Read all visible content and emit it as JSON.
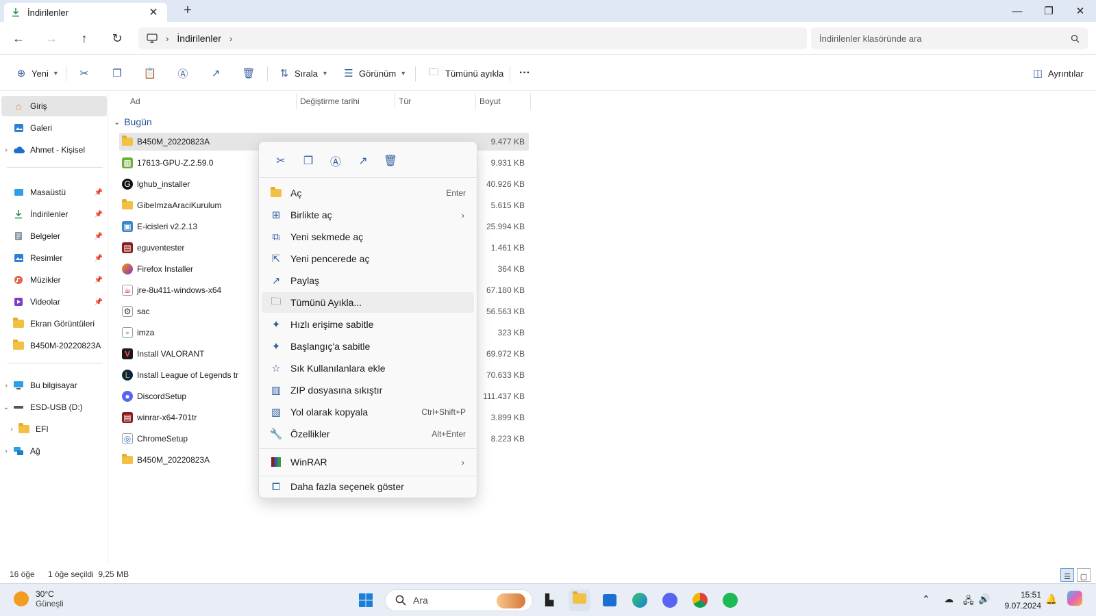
{
  "window": {
    "tab_title": "İndirilenler",
    "close_tab": "✕",
    "new_tab": "+",
    "minimize": "—",
    "maximize": "❐",
    "close": "✕"
  },
  "navigation": {
    "breadcrumb": [
      "İndirilenler"
    ],
    "search_placeholder": "İndirilenler klasöründe ara"
  },
  "commandbar": {
    "new": "Yeni",
    "sort": "Sırala",
    "view": "Görünüm",
    "extract_all": "Tümünü ayıkla",
    "more": "···",
    "details": "Ayrıntılar"
  },
  "sidebar": {
    "items": [
      {
        "label": "Giriş",
        "icon": "home-icon"
      },
      {
        "label": "Galeri",
        "icon": "gallery-icon"
      },
      {
        "label": "Ahmet - Kişisel",
        "icon": "onedrive-icon"
      },
      {
        "label": "Masaüstü",
        "icon": "desktop-icon"
      },
      {
        "label": "İndirilenler",
        "icon": "download-icon"
      },
      {
        "label": "Belgeler",
        "icon": "documents-icon"
      },
      {
        "label": "Resimler",
        "icon": "pictures-icon"
      },
      {
        "label": "Müzikler",
        "icon": "music-icon"
      },
      {
        "label": "Videolar",
        "icon": "videos-icon"
      },
      {
        "label": "Ekran Görüntüleri",
        "icon": "folder-icon"
      },
      {
        "label": "B450M-20220823A",
        "icon": "folder-icon"
      },
      {
        "label": "Bu bilgisayar",
        "icon": "this-pc-icon"
      },
      {
        "label": "ESD-USB (D:)",
        "icon": "usb-drive-icon"
      },
      {
        "label": "EFI",
        "icon": "folder-icon"
      },
      {
        "label": "Ağ",
        "icon": "network-icon"
      }
    ]
  },
  "filelist": {
    "columns": [
      "Ad",
      "Değiştirme tarihi",
      "Tür",
      "Boyut"
    ],
    "group": "Bugün",
    "files": [
      {
        "name": "B450M_20220823A",
        "size": "9.477 KB"
      },
      {
        "name": "17613-GPU-Z.2.59.0",
        "size": "9.931 KB"
      },
      {
        "name": "lghub_installer",
        "size": "40.926 KB"
      },
      {
        "name": "GibeImzaAraciKurulum",
        "size": "5.615 KB"
      },
      {
        "name": "E-icisleri v2.2.13",
        "size": "25.994 KB"
      },
      {
        "name": "eguventester",
        "size": "1.461 KB"
      },
      {
        "name": "Firefox Installer",
        "size": "364 KB"
      },
      {
        "name": "jre-8u411-windows-x64",
        "size": "67.180 KB"
      },
      {
        "name": "sac",
        "size": "56.563 KB"
      },
      {
        "name": "imza",
        "size": "323 KB"
      },
      {
        "name": "Install VALORANT",
        "size": "69.972 KB"
      },
      {
        "name": "Install League of Legends tr",
        "size": "70.633 KB"
      },
      {
        "name": "DiscordSetup",
        "size": "111.437 KB"
      },
      {
        "name": "winrar-x64-701tr",
        "size": "3.899 KB"
      },
      {
        "name": "ChromeSetup",
        "size": "8.223 KB"
      },
      {
        "name": "B450M_20220823A",
        "size": ""
      }
    ]
  },
  "context_menu": {
    "items": [
      {
        "label": "Aç",
        "shortcut": "Enter"
      },
      {
        "label": "Birlikte aç",
        "shortcut": ""
      },
      {
        "label": "Yeni sekmede aç",
        "shortcut": ""
      },
      {
        "label": "Yeni pencerede aç",
        "shortcut": ""
      },
      {
        "label": "Paylaş",
        "shortcut": ""
      },
      {
        "label": "Tümünü Ayıkla...",
        "shortcut": ""
      },
      {
        "label": "Hızlı erişime sabitle",
        "shortcut": ""
      },
      {
        "label": "Başlangıç'a sabitle",
        "shortcut": ""
      },
      {
        "label": "Sık Kullanılanlara ekle",
        "shortcut": ""
      },
      {
        "label": "ZIP dosyasına sıkıştır",
        "shortcut": ""
      },
      {
        "label": "Yol olarak kopyala",
        "shortcut": "Ctrl+Shift+P"
      },
      {
        "label": "Özellikler",
        "shortcut": "Alt+Enter"
      },
      {
        "label": "WinRAR",
        "shortcut": ""
      },
      {
        "label": "Daha fazla seçenek göster",
        "shortcut": ""
      }
    ]
  },
  "statusbar": {
    "count": "16 öğe",
    "selection": "1 öğe seçildi  9,25 MB"
  },
  "taskbar": {
    "temperature": "30°C",
    "condition": "Güneşli",
    "search": "Ara",
    "time": "15:51",
    "date": "9.07.2024"
  }
}
